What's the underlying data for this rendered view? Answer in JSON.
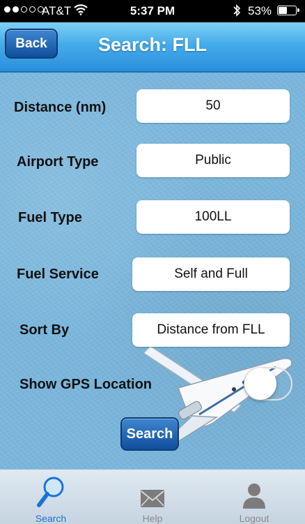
{
  "status_bar": {
    "carrier": "AT&T",
    "time": "5:37 PM",
    "battery": "53%",
    "battery_level": 0.53
  },
  "nav": {
    "back_label": "Back",
    "title": "Search: FLL"
  },
  "form": {
    "distance": {
      "label": "Distance (nm)",
      "value": "50"
    },
    "airport_type": {
      "label": "Airport Type",
      "value": "Public"
    },
    "fuel_type": {
      "label": "Fuel Type",
      "value": "100LL"
    },
    "fuel_service": {
      "label": "Fuel Service",
      "value": "Self and Full"
    },
    "sort_by": {
      "label": "Sort By",
      "value": "Distance from FLL"
    },
    "gps": {
      "label": "Show GPS Location",
      "enabled": false
    },
    "search_label": "Search"
  },
  "tabs": [
    {
      "label": "Search",
      "icon": "magnifier-icon",
      "active": true
    },
    {
      "label": "Help",
      "icon": "envelope-icon",
      "active": false
    },
    {
      "label": "Logout",
      "icon": "person-icon",
      "active": false
    }
  ],
  "colors": {
    "nav_blue": "#2b8fdc",
    "button_blue": "#0f4f9b",
    "background": "#7ab6dc",
    "tab_active": "#1a73d6"
  }
}
